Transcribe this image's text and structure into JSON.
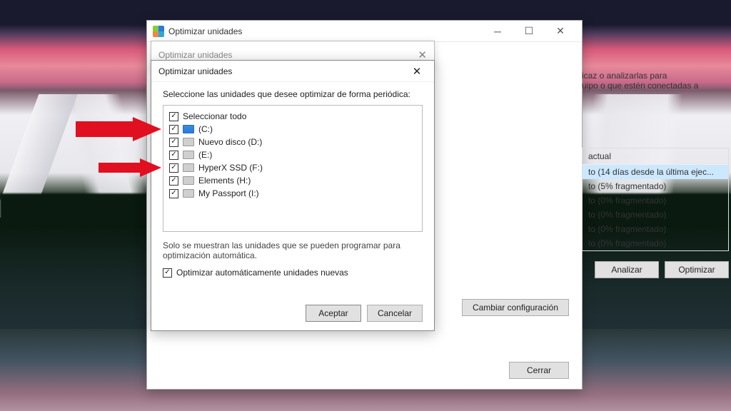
{
  "main_window": {
    "title": "Optimizar unidades",
    "desc_line1": "icaz o analizarlas para",
    "desc_line2": "uipo o que estén conectadas a",
    "status_header": "actual",
    "statuses": [
      "to (14 días desde la última ejec...",
      "to (5% fragmentado)",
      "to (0% fragmentado)",
      "to (0% fragmentado)",
      "to (0% fragmentado)",
      "to (0% fragmentado)"
    ],
    "btn_analyze": "Analizar",
    "btn_optimize": "Optimizar",
    "btn_change": "Cambiar configuración",
    "btn_close": "Cerrar"
  },
  "mid_dialog": {
    "title": "Optimizar unidades"
  },
  "top_dialog": {
    "title": "Optimizar unidades",
    "instruction": "Seleccione las unidades que desee optimizar de forma periódica:",
    "select_all": "Seleccionar todo",
    "drives": [
      {
        "label": "(C:)",
        "sys": true
      },
      {
        "label": "Nuevo disco (D:)",
        "sys": false
      },
      {
        "label": "(E:)",
        "sys": false
      },
      {
        "label": "HyperX SSD (F:)",
        "sys": false
      },
      {
        "label": "Elements (H:)",
        "sys": false
      },
      {
        "label": "My Passport (I:)",
        "sys": false
      }
    ],
    "note": "Solo se muestran las unidades que se pueden programar para optimización automática.",
    "auto_new": "Optimizar automáticamente unidades nuevas",
    "btn_ok": "Aceptar",
    "btn_cancel": "Cancelar"
  }
}
